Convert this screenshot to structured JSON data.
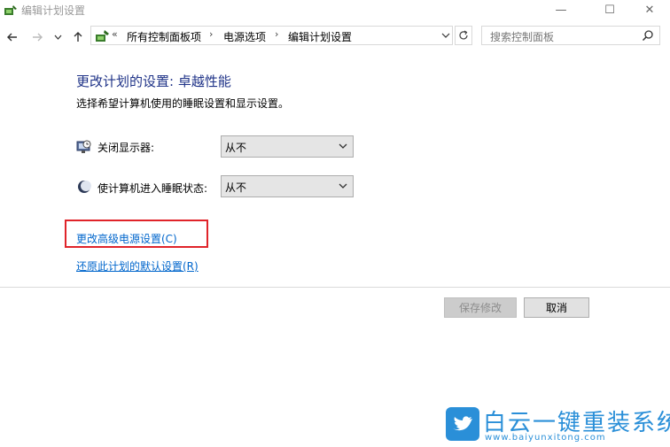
{
  "window": {
    "title": "编辑计划设置",
    "minimize": "—",
    "maximize": "☐",
    "close": "✕"
  },
  "nav": {
    "back_icon": "arrow-left-icon",
    "forward_icon": "arrow-right-icon",
    "recent_icon": "chevron-down-icon",
    "up_icon": "arrow-up-icon",
    "overflow": "«",
    "breadcrumbs": [
      "所有控制面板项",
      "电源选项",
      "编辑计划设置"
    ],
    "refresh_icon": "refresh-icon",
    "search_placeholder": "搜索控制面板"
  },
  "content": {
    "heading": "更改计划的设置: 卓越性能",
    "subheading": "选择希望计算机使用的睡眠设置和显示设置。",
    "settings": [
      {
        "label": "关闭显示器:",
        "value": "从不",
        "icon": "monitor-clock-icon"
      },
      {
        "label": "使计算机进入睡眠状态:",
        "value": "从不",
        "icon": "moon-icon"
      }
    ],
    "advanced_link": "更改高级电源设置(C)",
    "restore_link": "还原此计划的默认设置(R)",
    "highlight_color": "#e0242a"
  },
  "footer": {
    "save_label": "保存修改",
    "cancel_label": "取消"
  },
  "watermark": {
    "title": "白云一键重装系统",
    "url": "www.baiyunxitong.com",
    "color": "#2a8fd8"
  }
}
